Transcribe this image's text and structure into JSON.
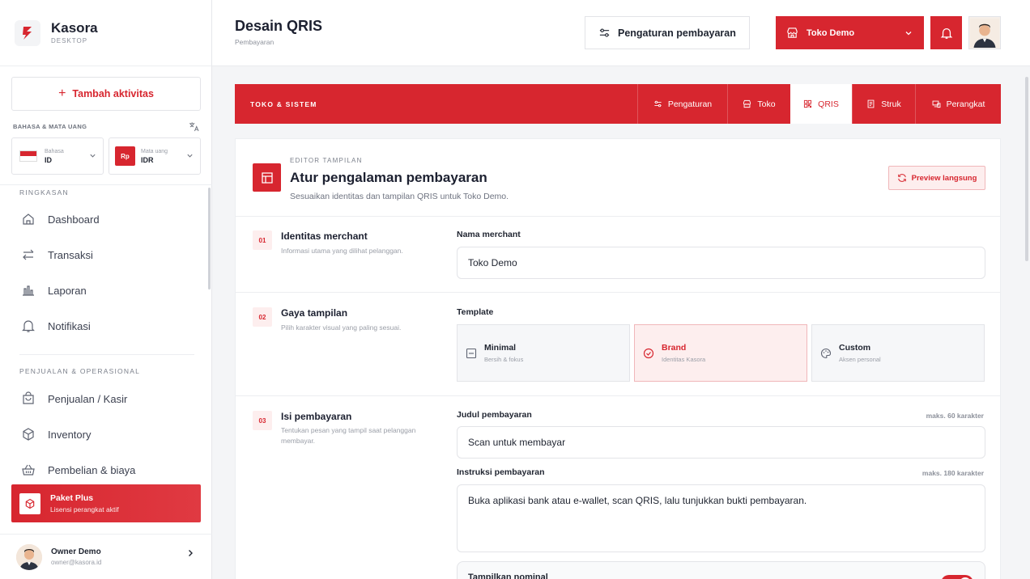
{
  "brand": {
    "name": "Kasora",
    "sub": "DESKTOP"
  },
  "sidebar": {
    "add_label": "Tambah aktivitas",
    "lang_section": "BAHASA & MATA UANG",
    "language": {
      "label": "Bahasa",
      "value": "ID"
    },
    "currency": {
      "label": "Mata uang",
      "value": "IDR",
      "badge": "Rp"
    },
    "summary_title": "RINGKASAN",
    "summary_items": [
      {
        "label": "Dashboard",
        "icon": "home-icon"
      },
      {
        "label": "Transaksi",
        "icon": "transfer-icon"
      },
      {
        "label": "Laporan",
        "icon": "chart-icon"
      },
      {
        "label": "Notifikasi",
        "icon": "bell-icon"
      }
    ],
    "ops_title": "PENJUALAN & OPERASIONAL",
    "ops_items": [
      {
        "label": "Penjualan / Kasir",
        "icon": "bag-icon"
      },
      {
        "label": "Inventory",
        "icon": "box-icon"
      },
      {
        "label": "Pembelian & biaya",
        "icon": "basket-icon"
      }
    ],
    "plan": {
      "title": "Paket Plus",
      "desc": "Lisensi perangkat aktif"
    },
    "user": {
      "name": "Owner Demo",
      "email": "owner@kasora.id"
    }
  },
  "header": {
    "title": "Desain QRIS",
    "subtitle": "Pembayaran",
    "payment_settings": "Pengaturan pembayaran",
    "store": "Toko Demo"
  },
  "tabbar": {
    "title": "TOKO & SISTEM",
    "tabs": [
      {
        "label": "Pengaturan",
        "active": false
      },
      {
        "label": "Toko",
        "active": false
      },
      {
        "label": "QRIS",
        "active": true
      },
      {
        "label": "Struk",
        "active": false
      },
      {
        "label": "Perangkat",
        "active": false
      }
    ]
  },
  "editor": {
    "overline": "EDITOR TAMPILAN",
    "title": "Atur pengalaman pembayaran",
    "desc": "Sesuaikan identitas dan tampilan QRIS untuk Toko Demo.",
    "preview": "Preview langsung",
    "sections": [
      {
        "num": "01",
        "title": "Identitas merchant",
        "desc": "Informasi utama yang dilihat pelanggan."
      },
      {
        "num": "02",
        "title": "Gaya tampilan",
        "desc": "Pilih karakter visual yang paling sesuai."
      },
      {
        "num": "03",
        "title": "Isi pembayaran",
        "desc": "Tentukan pesan yang tampil saat pelanggan membayar."
      }
    ],
    "merchant_label": "Nama merchant",
    "merchant_value": "Toko Demo",
    "template_label": "Template",
    "templates": [
      {
        "title": "Minimal",
        "desc": "Bersih & fokus"
      },
      {
        "title": "Brand",
        "desc": "Identitas Kasora",
        "selected": true
      },
      {
        "title": "Custom",
        "desc": "Aksen personal"
      }
    ],
    "judul_label": "Judul pembayaran",
    "judul_max": "maks. 60 karakter",
    "judul_value": "Scan untuk membayar",
    "instr_label": "Instruksi pembayaran",
    "instr_max": "maks. 180 karakter",
    "instr_value": "Buka aplikasi bank atau e-wallet, scan QRIS, lalu tunjukkan bukti pembayaran.",
    "toggle_label": "Tampilkan nominal",
    "toggle_on": true
  },
  "colors": {
    "accent": "#d7262f",
    "accent_soft": "#fdeeee"
  }
}
